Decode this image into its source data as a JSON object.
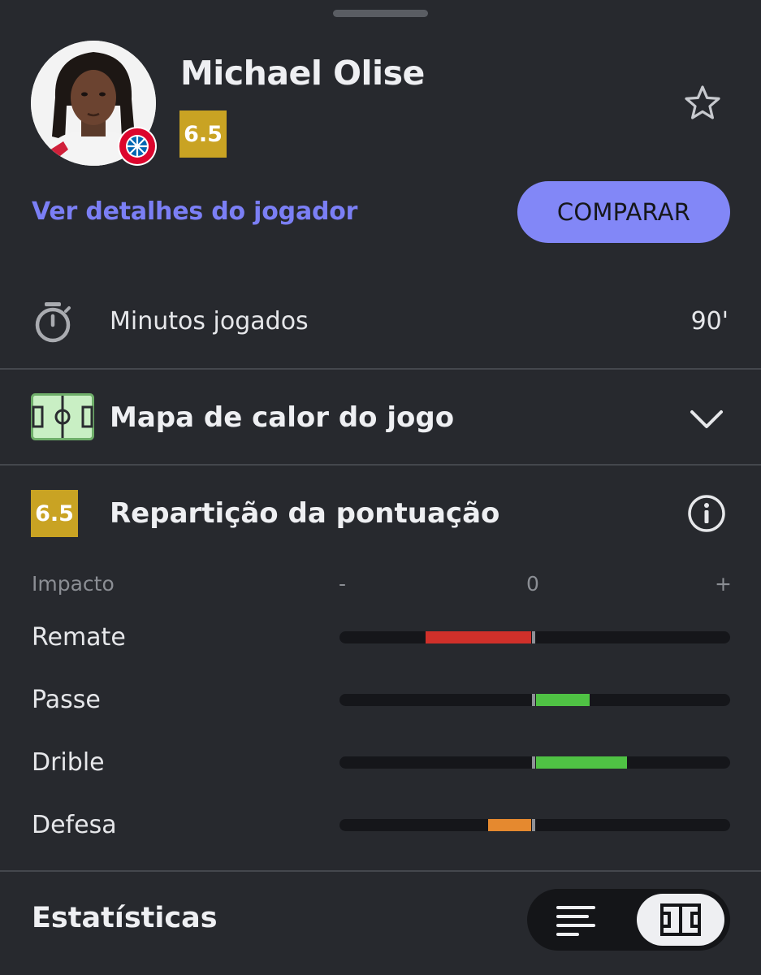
{
  "player": {
    "name": "Michael Olise",
    "rating": "6.5",
    "club_badge_text": "FC BAYERN MÜNCHEN"
  },
  "actions": {
    "details_link": "Ver detalhes do jogador",
    "compare_label": "COMPARAR"
  },
  "minutes": {
    "label": "Minutos jogados",
    "value": "90'"
  },
  "heatmap": {
    "label": "Mapa de calor do jogo"
  },
  "breakdown": {
    "rating": "6.5",
    "title": "Repartição da pontuação",
    "impact_label": "Impacto",
    "axis": {
      "minus": "-",
      "zero": "0",
      "plus": "+"
    },
    "metrics": [
      {
        "label": "Remate",
        "impact": -0.56,
        "color": "#d0302a"
      },
      {
        "label": "Passe",
        "impact": 0.28,
        "color": "#4fc244"
      },
      {
        "label": "Drible",
        "impact": 0.47,
        "color": "#4fc244"
      },
      {
        "label": "Defesa",
        "impact": -0.24,
        "color": "#e5892f"
      }
    ]
  },
  "stats": {
    "title": "Estatísticas"
  },
  "colors": {
    "accent": "#8287f7",
    "rating": "#c9a323",
    "background": "#27292e"
  },
  "icons": {
    "favorite": "star-outline-icon",
    "timer": "stopwatch-icon",
    "heatmap": "pitch-icon",
    "expand": "chevron-down-icon",
    "info": "info-icon",
    "list_view": "list-icon",
    "pitch_view": "pitch-view-icon"
  }
}
